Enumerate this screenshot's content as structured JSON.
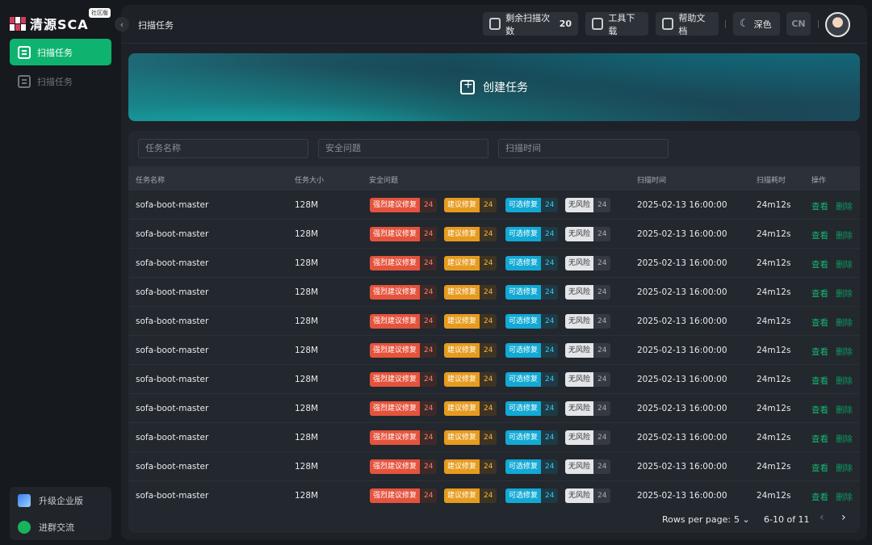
{
  "app": {
    "logo_text": "清源SCA",
    "edition": "社区版"
  },
  "sidebar": {
    "items": [
      {
        "label": "扫描任务",
        "active": true
      },
      {
        "label": "扫描任务",
        "active": false
      }
    ],
    "bottom": [
      {
        "label": "升级企业版",
        "icon": "upgrade-icon"
      },
      {
        "label": "进群交流",
        "icon": "wechat-icon"
      }
    ]
  },
  "topbar": {
    "title": "扫描任务",
    "remaining_label": "剩余扫描次数",
    "remaining_count": "20",
    "tools_label": "工具下载",
    "docs_label": "帮助文档",
    "theme_label": "深色",
    "lang_label": "CN"
  },
  "banner": {
    "create_label": "创建任务"
  },
  "filters": {
    "task_name_placeholder": "任务名称",
    "security_placeholder": "安全问题",
    "scan_time_placeholder": "扫描时间"
  },
  "table": {
    "columns": [
      "任务名称",
      "任务大小",
      "安全问题",
      "扫描时间",
      "扫描耗时",
      "操作"
    ],
    "tag_labels": {
      "strong": "强烈建议修复",
      "suggest": "建议修复",
      "optional": "可选修复",
      "none": "无风险"
    },
    "actions": {
      "view": "查看",
      "delete": "删除"
    },
    "rows": [
      {
        "name": "sofa-boot-master",
        "size": "128M",
        "strong": "24",
        "suggest": "24",
        "optional": "24",
        "none": "24",
        "time": "2025-02-13 16:00:00",
        "duration": "24m12s"
      },
      {
        "name": "sofa-boot-master",
        "size": "128M",
        "strong": "24",
        "suggest": "24",
        "optional": "24",
        "none": "24",
        "time": "2025-02-13 16:00:00",
        "duration": "24m12s"
      },
      {
        "name": "sofa-boot-master",
        "size": "128M",
        "strong": "24",
        "suggest": "24",
        "optional": "24",
        "none": "24",
        "time": "2025-02-13 16:00:00",
        "duration": "24m12s"
      },
      {
        "name": "sofa-boot-master",
        "size": "128M",
        "strong": "24",
        "suggest": "24",
        "optional": "24",
        "none": "24",
        "time": "2025-02-13 16:00:00",
        "duration": "24m12s"
      },
      {
        "name": "sofa-boot-master",
        "size": "128M",
        "strong": "24",
        "suggest": "24",
        "optional": "24",
        "none": "24",
        "time": "2025-02-13 16:00:00",
        "duration": "24m12s"
      },
      {
        "name": "sofa-boot-master",
        "size": "128M",
        "strong": "24",
        "suggest": "24",
        "optional": "24",
        "none": "24",
        "time": "2025-02-13 16:00:00",
        "duration": "24m12s"
      },
      {
        "name": "sofa-boot-master",
        "size": "128M",
        "strong": "24",
        "suggest": "24",
        "optional": "24",
        "none": "24",
        "time": "2025-02-13 16:00:00",
        "duration": "24m12s"
      },
      {
        "name": "sofa-boot-master",
        "size": "128M",
        "strong": "24",
        "suggest": "24",
        "optional": "24",
        "none": "24",
        "time": "2025-02-13 16:00:00",
        "duration": "24m12s"
      },
      {
        "name": "sofa-boot-master",
        "size": "128M",
        "strong": "24",
        "suggest": "24",
        "optional": "24",
        "none": "24",
        "time": "2025-02-13 16:00:00",
        "duration": "24m12s"
      },
      {
        "name": "sofa-boot-master",
        "size": "128M",
        "strong": "24",
        "suggest": "24",
        "optional": "24",
        "none": "24",
        "time": "2025-02-13 16:00:00",
        "duration": "24m12s"
      },
      {
        "name": "sofa-boot-master",
        "size": "128M",
        "strong": "24",
        "suggest": "24",
        "optional": "24",
        "none": "24",
        "time": "2025-02-13 16:00:00",
        "duration": "24m12s"
      }
    ]
  },
  "pagination": {
    "rows_per_page_label": "Rows per page:",
    "rows_per_page": "5",
    "range": "6-10 of 11"
  },
  "colors": {
    "accent": "#0eb36f",
    "danger": "#e5533d",
    "warning": "#e69b1e",
    "info": "#12a9d4"
  }
}
